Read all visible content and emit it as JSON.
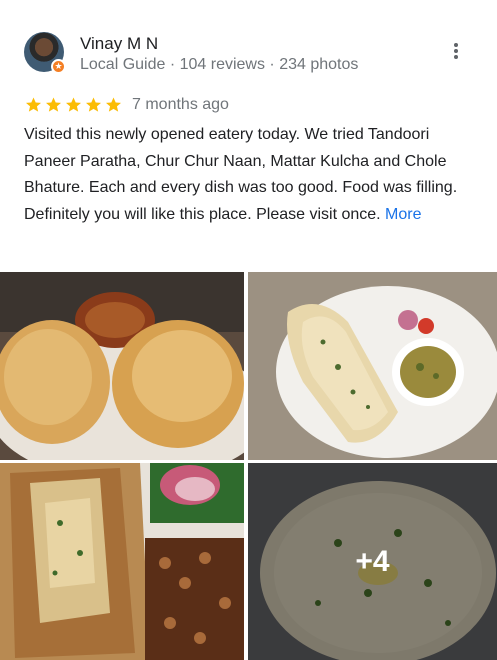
{
  "reviewer": {
    "name": "Vinay M N",
    "meta": "Local Guide · 104 reviews · 234 photos"
  },
  "review": {
    "rating": 5,
    "time": "7 months ago",
    "text": "Visited this newly opened eatery today. We tried Tandoori Paneer Paratha, Chur Chur Naan, Mattar Kulcha and Chole Bhature. Each and every dish was too good. Food was filling. Definitely you will like this place. Please visit once.",
    "more_label": "More"
  },
  "photos": {
    "more_count_label": "+4"
  },
  "colors": {
    "star": "#fbbc04",
    "link": "#1a73e8",
    "secondary_text": "#70757a",
    "local_guide_badge": "#f47f24"
  }
}
